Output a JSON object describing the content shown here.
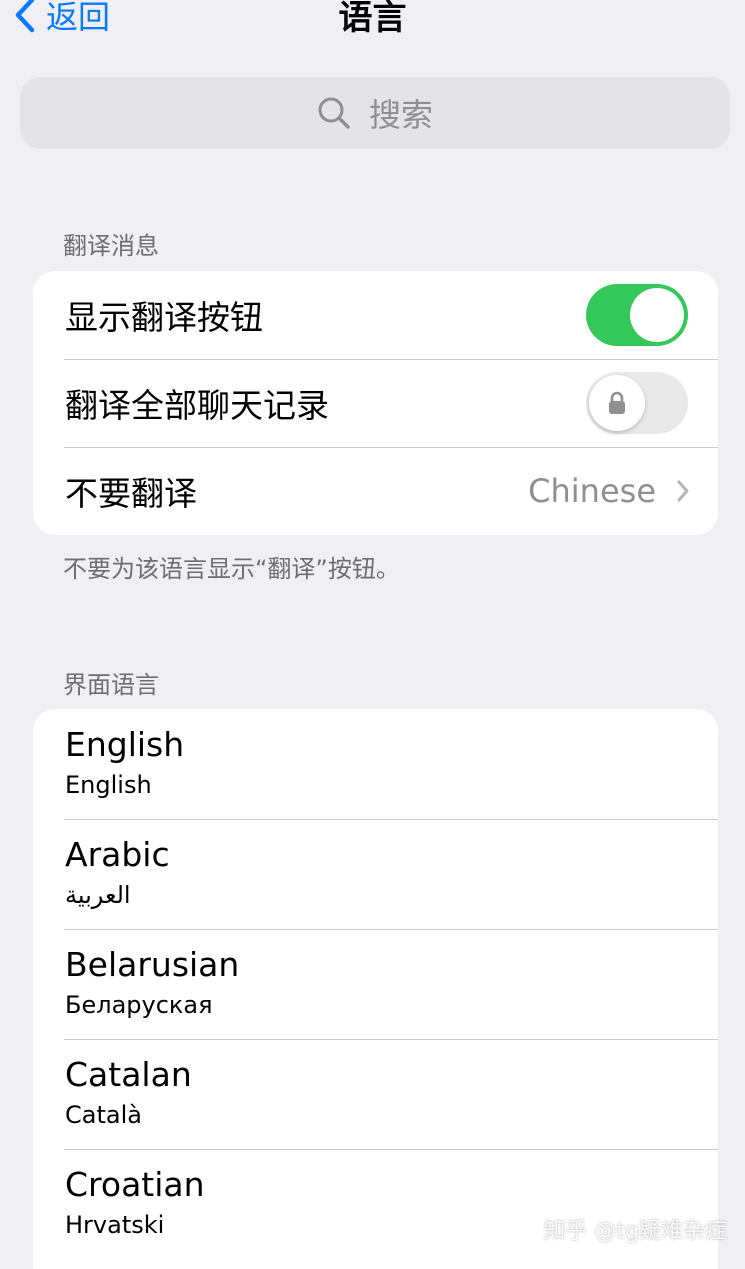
{
  "nav": {
    "back_label": "返回",
    "title": "语言"
  },
  "search": {
    "placeholder": "搜索"
  },
  "translation": {
    "section_label": "翻译消息",
    "rows": [
      {
        "label": "显示翻译按钮",
        "toggle": "on"
      },
      {
        "label": "翻译全部聊天记录",
        "toggle": "off-locked"
      },
      {
        "label": "不要翻译",
        "value": "Chinese"
      }
    ],
    "footer": "不要为该语言显示“翻译”按钮。"
  },
  "interface": {
    "section_label": "界面语言",
    "languages": [
      {
        "name": "English",
        "native": "English"
      },
      {
        "name": "Arabic",
        "native": "العربية"
      },
      {
        "name": "Belarusian",
        "native": "Беларуская"
      },
      {
        "name": "Catalan",
        "native": "Català"
      },
      {
        "name": "Croatian",
        "native": "Hrvatski"
      }
    ]
  },
  "watermark": "知乎 @tg疑难杂症",
  "colors": {
    "accent": "#0a7aff",
    "toggle_on": "#34c759",
    "background": "#efeff4",
    "secondary_text": "#8e8e93"
  }
}
